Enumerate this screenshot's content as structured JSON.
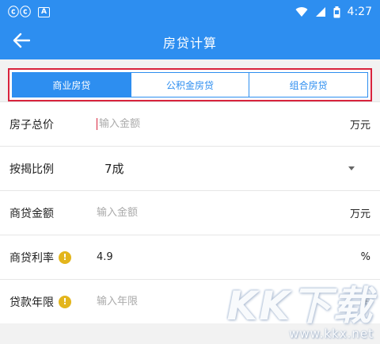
{
  "status_bar": {
    "app_icons": "ⓒⓒ",
    "notification_icon": "A",
    "time": "4:27",
    "colors": {
      "background": "#2d8ef0"
    }
  },
  "app_bar": {
    "title": "房贷计算",
    "back_icon": "arrow-left-icon"
  },
  "tabs": [
    {
      "label": "商业房贷",
      "active": true
    },
    {
      "label": "公积金房贷",
      "active": false
    },
    {
      "label": "组合房贷",
      "active": false
    }
  ],
  "form": {
    "total_price": {
      "label": "房子总价",
      "placeholder": "输入金额",
      "value": "",
      "unit": "万元"
    },
    "down_payment_ratio": {
      "label": "按揭比例",
      "value": "7成"
    },
    "commercial_loan_amount": {
      "label": "商贷金额",
      "placeholder": "输入金额",
      "value": "",
      "unit": "万元"
    },
    "commercial_rate": {
      "label": "商贷利率",
      "info_icon": "!",
      "value": "4.9",
      "unit": "%"
    },
    "loan_years": {
      "label": "贷款年限",
      "info_icon": "!",
      "placeholder": "输入年限",
      "value": "",
      "unit": "年"
    }
  },
  "watermark": {
    "logo_text": "KK下载",
    "url": "www.kkx.net"
  },
  "colors": {
    "primary": "#2d8ef0",
    "highlight_border": "#d8243d",
    "info": "#e3b51c"
  }
}
